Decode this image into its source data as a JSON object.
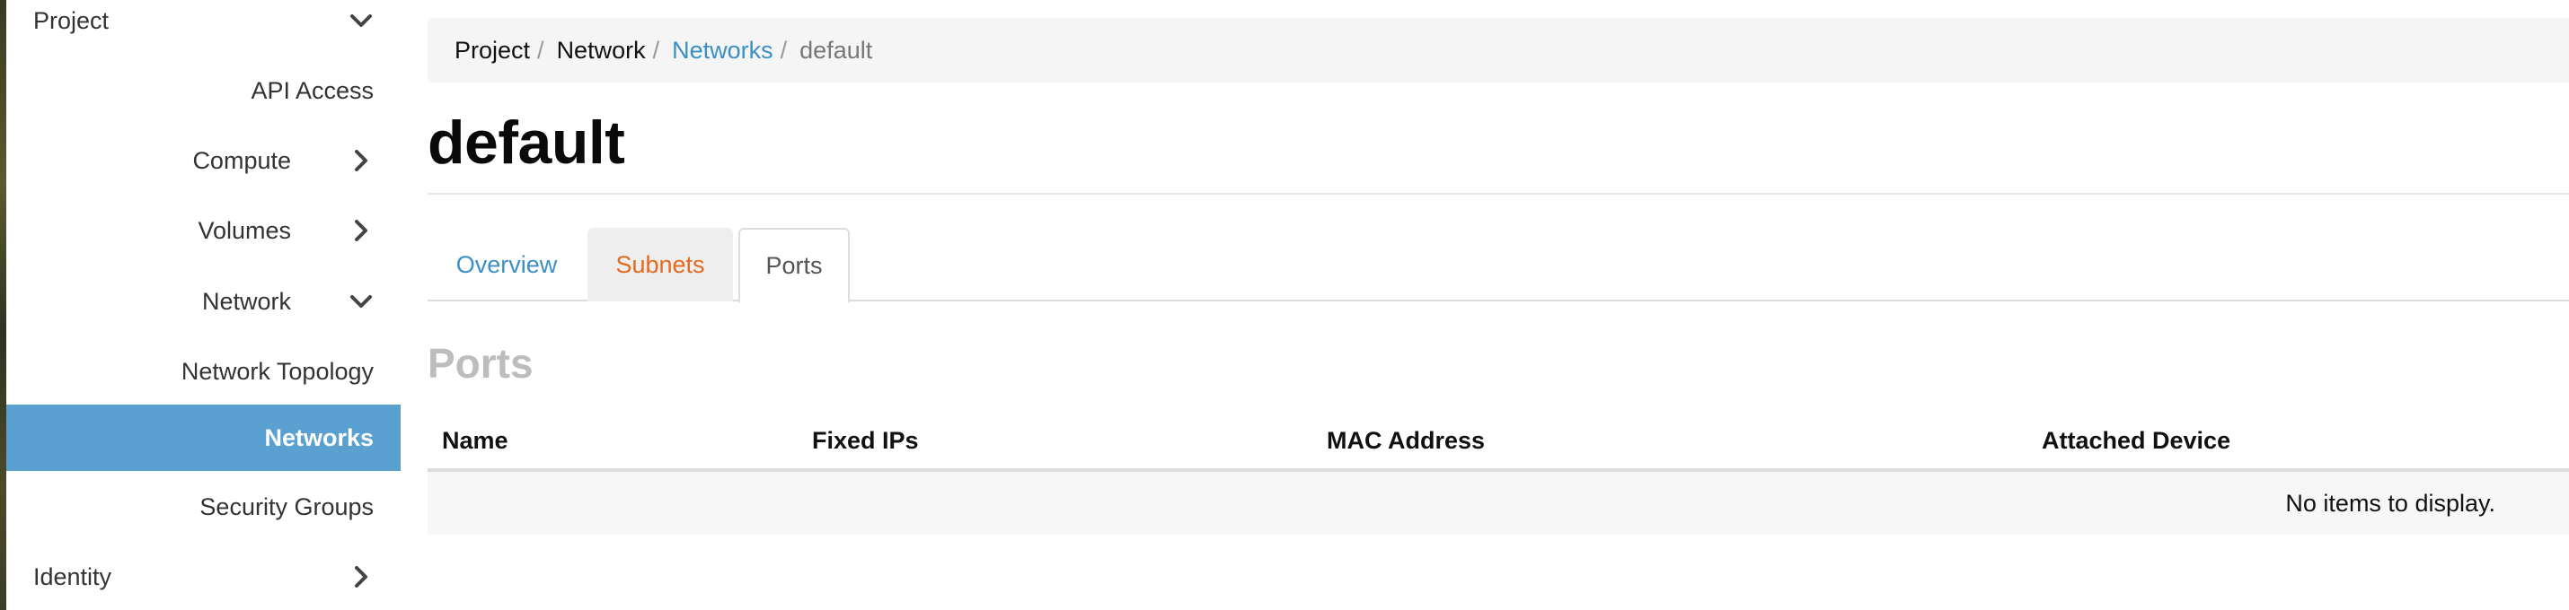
{
  "sidebar": {
    "project": "Project",
    "api_access": "API Access",
    "compute": "Compute",
    "volumes": "Volumes",
    "network": "Network",
    "network_topology": "Network Topology",
    "networks": "Networks",
    "security_groups": "Security Groups",
    "identity": "Identity",
    "active_color": "#5aa0d0"
  },
  "breadcrumb": {
    "items": [
      "Project",
      "Network",
      "Networks",
      "default"
    ],
    "separator": "/"
  },
  "page": {
    "title": "default"
  },
  "tabs": [
    {
      "label": "Overview"
    },
    {
      "label": "Subnets"
    },
    {
      "label": "Ports"
    }
  ],
  "ports": {
    "title": "Ports",
    "columns": [
      "Name",
      "Fixed IPs",
      "MAC Address",
      "Attached Device"
    ],
    "rows": [],
    "empty_message": "No items to display."
  },
  "colors": {
    "link": "#3b8fc7",
    "subnets_tab": "#e5691e"
  },
  "icons": {
    "expanded": "chevron-down-icon",
    "collapsed": "chevron-right-icon"
  }
}
